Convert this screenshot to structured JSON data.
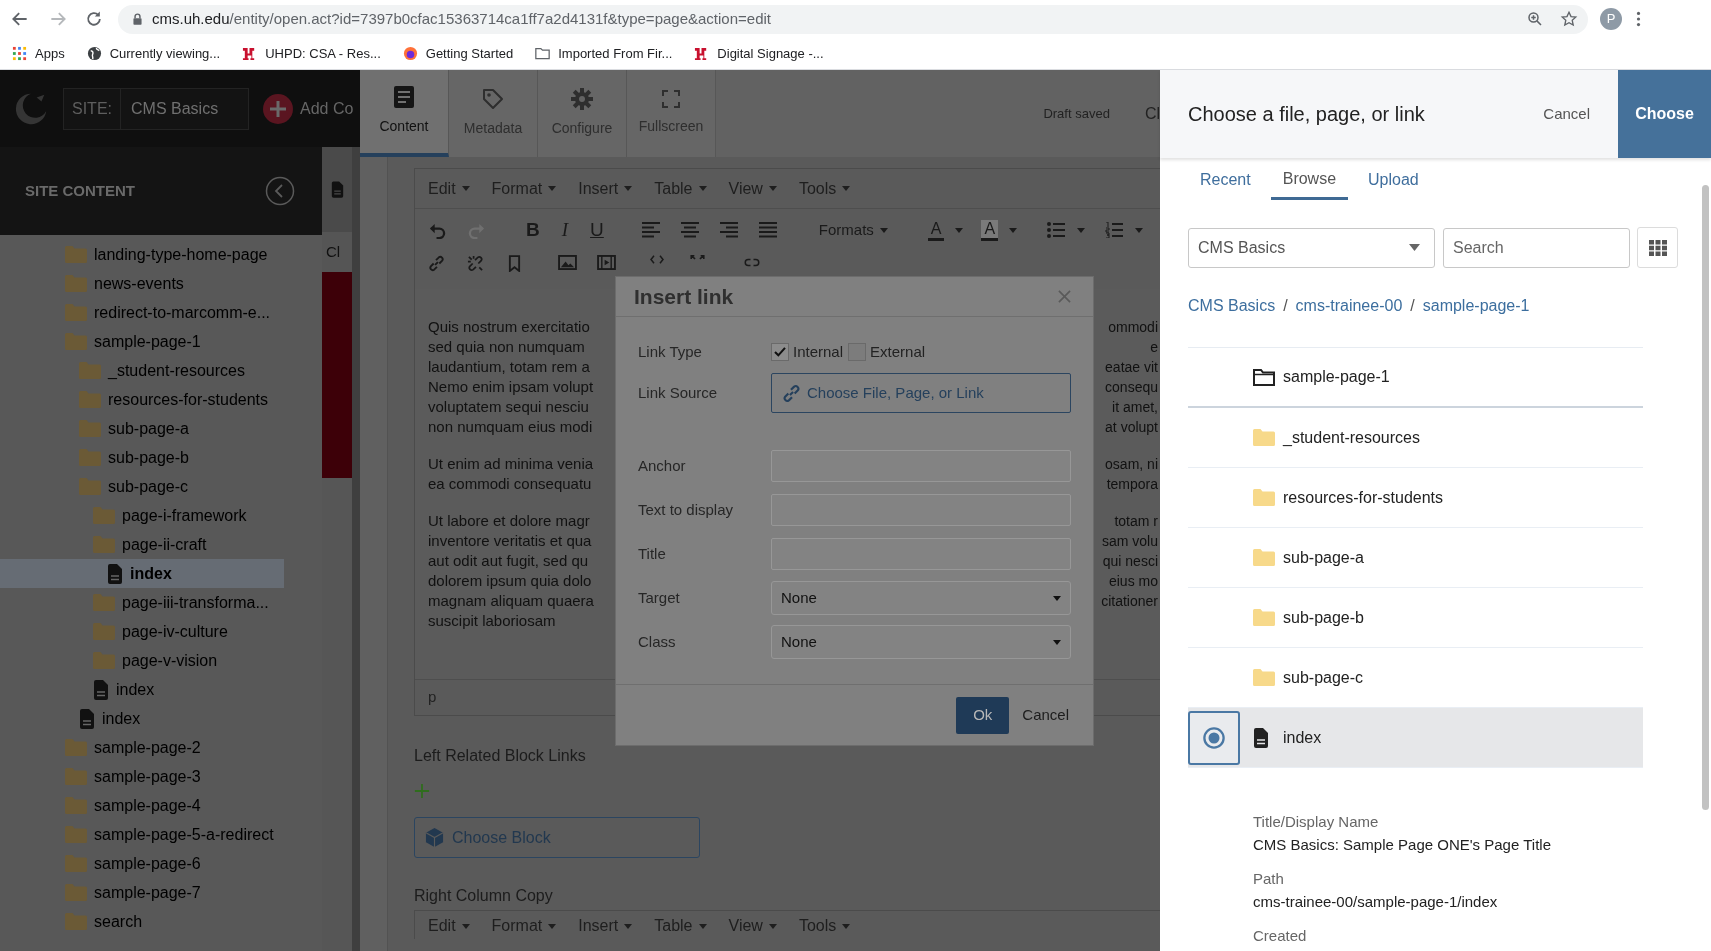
{
  "browser": {
    "url_host": "cms.uh.edu",
    "url_rest": "/entity/open.act?id=7397b0cfac15363714ca1ff7a2d4131f&type=page&action=edit",
    "profile_initial": "P",
    "bookmarks": [
      {
        "label": "Apps",
        "kind": "apps"
      },
      {
        "label": "Currently viewing...",
        "kind": "globe"
      },
      {
        "label": "UHPD: CSA - Res...",
        "kind": "uh"
      },
      {
        "label": "Getting Started",
        "kind": "firefox"
      },
      {
        "label": "Imported From Fir...",
        "kind": "folder"
      },
      {
        "label": "Digital Signage -...",
        "kind": "uh"
      }
    ]
  },
  "app_header": {
    "site_label": "SITE:",
    "site_name": "CMS Basics",
    "add_label": "Add Co"
  },
  "sidebar": {
    "title": "SITE CONTENT",
    "tree": [
      {
        "label": "landing-type-home-page",
        "kind": "folder",
        "selected": false
      },
      {
        "label": "news-events",
        "kind": "folder",
        "selected": false
      },
      {
        "label": "redirect-to-marcomm-e...",
        "kind": "folder",
        "selected": false
      },
      {
        "label": "sample-page-1",
        "kind": "folder",
        "selected": false,
        "children": [
          {
            "label": "_student-resources",
            "kind": "folder",
            "selected": false
          },
          {
            "label": "resources-for-students",
            "kind": "folder",
            "selected": false
          },
          {
            "label": "sub-page-a",
            "kind": "folder",
            "selected": false
          },
          {
            "label": "sub-page-b",
            "kind": "folder",
            "selected": false
          },
          {
            "label": "sub-page-c",
            "kind": "folder",
            "selected": false,
            "children": [
              {
                "label": "page-i-framework",
                "kind": "folder",
                "selected": false
              },
              {
                "label": "page-ii-craft",
                "kind": "folder",
                "selected": false,
                "children": [
                  {
                    "label": "index",
                    "kind": "page",
                    "selected": true
                  }
                ]
              },
              {
                "label": "page-iii-transforma...",
                "kind": "folder",
                "selected": false
              },
              {
                "label": "page-iv-culture",
                "kind": "folder",
                "selected": false
              },
              {
                "label": "page-v-vision",
                "kind": "folder",
                "selected": false
              },
              {
                "label": "index",
                "kind": "page",
                "selected": false
              }
            ]
          },
          {
            "label": "index",
            "kind": "page",
            "selected": false
          }
        ]
      },
      {
        "label": "sample-page-2",
        "kind": "folder",
        "selected": false
      },
      {
        "label": "sample-page-3",
        "kind": "folder",
        "selected": false
      },
      {
        "label": "sample-page-4",
        "kind": "folder",
        "selected": false
      },
      {
        "label": "sample-page-5-a-redirect",
        "kind": "folder",
        "selected": false
      },
      {
        "label": "sample-page-6",
        "kind": "folder",
        "selected": false
      },
      {
        "label": "sample-page-7",
        "kind": "folder",
        "selected": false
      },
      {
        "label": "search",
        "kind": "folder",
        "selected": false
      }
    ]
  },
  "preview_strip": {
    "label": "Cl"
  },
  "editor": {
    "tabs": [
      {
        "label": "Content",
        "kind": "content",
        "selected": true
      },
      {
        "label": "Metadata",
        "kind": "metadata",
        "selected": false
      },
      {
        "label": "Configure",
        "kind": "configure",
        "selected": false
      },
      {
        "label": "Fullscreen",
        "kind": "fullscreen",
        "selected": false
      }
    ],
    "status": "Draft saved",
    "close_label": "Cl",
    "menu": [
      "Edit",
      "Format",
      "Insert",
      "Table",
      "View",
      "Tools"
    ],
    "format_buttons": [
      "B",
      "I",
      "U"
    ],
    "formats_label": "Formats",
    "color_buttons": [
      "A",
      "A"
    ],
    "body": [
      [
        {
          "left": "Quis nostrum exercitatio",
          "right": "ommodi"
        },
        {
          "left": "sed quia non numquam",
          "right": "e"
        },
        {
          "left": "laudantium, totam rem a",
          "right": "eatae vit"
        },
        {
          "left": "Nemo enim ipsam volupt",
          "right": "consequ"
        },
        {
          "left": "voluptatem sequi nesciu",
          "right": "it amet,"
        },
        {
          "left": "non numquam eius modi",
          "right": "at volupt"
        }
      ],
      [
        {
          "left": "Ut enim ad minima venia",
          "right": "osam, ni"
        },
        {
          "left": "ea commodi consequatu",
          "right": "tempora"
        }
      ],
      [
        {
          "left": "Ut labore et dolore magr",
          "right": "totam r"
        },
        {
          "left": "inventore veritatis et qua",
          "right": "sam volu"
        },
        {
          "left": "aut odit aut fugit, sed qu",
          "right": "qui nesci"
        },
        {
          "left": "dolorem ipsum quia dolo",
          "right": "eius mo"
        },
        {
          "left": "magnam aliquam quaera",
          "right": "citationer"
        },
        {
          "left": "suscipit laboriosam"
        }
      ]
    ],
    "element_path": "p",
    "related_label": "Left Related Block Links",
    "choose_block": "Choose Block",
    "right_column_label": "Right Column Copy",
    "menu2": [
      "Edit",
      "Format",
      "Insert",
      "Table",
      "View",
      "Tools"
    ]
  },
  "dialog": {
    "title": "Insert link",
    "fields": [
      {
        "label": "Link Type",
        "kind": "checks",
        "options": [
          {
            "label": "Internal",
            "checked": true
          },
          {
            "label": "External",
            "checked": false
          }
        ]
      },
      {
        "label": "Link Source",
        "kind": "source",
        "value": "Choose File, Page, or Link"
      },
      {
        "label": "Anchor",
        "kind": "text"
      },
      {
        "label": "Text to display",
        "kind": "text"
      },
      {
        "label": "Title",
        "kind": "text"
      },
      {
        "label": "Target",
        "kind": "select",
        "value": "None"
      },
      {
        "label": "Class",
        "kind": "select",
        "value": "None"
      }
    ],
    "ok": "Ok",
    "cancel": "Cancel"
  },
  "picker": {
    "title": "Choose a file, page, or link",
    "cancel": "Cancel",
    "choose": "Choose",
    "tabs": [
      {
        "label": "Recent",
        "selected": false
      },
      {
        "label": "Browse",
        "selected": true
      },
      {
        "label": "Upload",
        "selected": false
      }
    ],
    "site_select": "CMS Basics",
    "search_placeholder": "Search",
    "breadcrumb": [
      {
        "text": "CMS Basics",
        "kind": "link"
      },
      {
        "text": "/",
        "kind": "separator"
      },
      {
        "text": "cms-trainee-00",
        "kind": "link"
      },
      {
        "text": "/",
        "kind": "separator"
      },
      {
        "text": "sample-page-1",
        "kind": "link"
      }
    ],
    "rows": [
      {
        "label": "sample-page-1",
        "kind": "current",
        "selected": false
      },
      {
        "label": "_student-resources",
        "kind": "folder",
        "selected": false
      },
      {
        "label": "resources-for-students",
        "kind": "folder",
        "selected": false
      },
      {
        "label": "sub-page-a",
        "kind": "folder",
        "selected": false
      },
      {
        "label": "sub-page-b",
        "kind": "folder",
        "selected": false
      },
      {
        "label": "sub-page-c",
        "kind": "folder",
        "selected": false
      },
      {
        "label": "index",
        "kind": "page",
        "selected": true
      }
    ],
    "details": [
      {
        "label": "Title/Display Name",
        "value": "CMS Basics: Sample Page ONE's Page Title"
      },
      {
        "label": "Path",
        "value": "cms-trainee-00/sample-page-1/index"
      },
      {
        "label": "Created"
      }
    ]
  }
}
